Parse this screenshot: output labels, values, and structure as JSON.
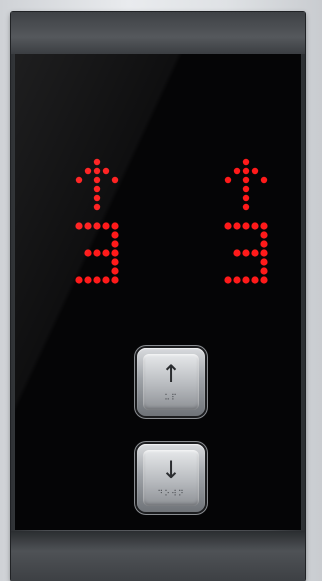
{
  "panel": {
    "left_indicator": {
      "direction": "up",
      "floor": "3",
      "icon": "up-arrow-icon"
    },
    "right_indicator": {
      "direction": "up",
      "floor": "3",
      "icon": "up-arrow-icon"
    },
    "led_color": "#ff1a1a",
    "buttons": {
      "up": {
        "arrow": "↑",
        "braille": "⠥⠏",
        "icon": "up-arrow-icon"
      },
      "down": {
        "arrow": "↓",
        "braille": "⠙⠕⠺⠝",
        "icon": "down-arrow-icon"
      }
    }
  }
}
